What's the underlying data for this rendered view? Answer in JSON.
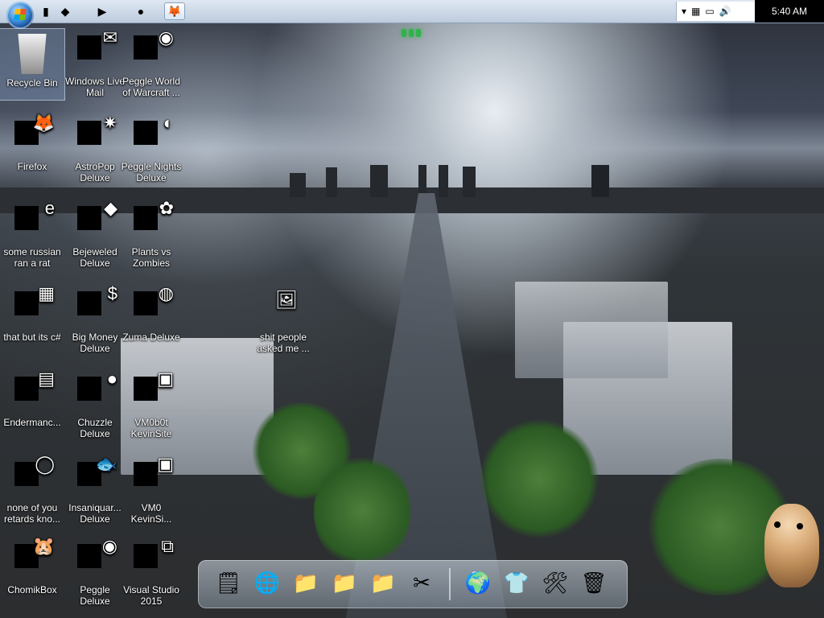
{
  "taskbar": {
    "start_icon": "windows-orb-icon",
    "items": [
      {
        "name": "app-red-square-icon",
        "glyph": "▮"
      },
      {
        "name": "app-black-shape-icon",
        "glyph": "◆"
      },
      {
        "name": "media-player-icon",
        "glyph": "▶"
      },
      {
        "name": "black-circle-icon",
        "glyph": "●"
      },
      {
        "name": "firefox-icon",
        "glyph": "🦊"
      }
    ],
    "tray": {
      "chevron_icon": "chevron-down-icon",
      "icons": [
        "network-icon",
        "monitor-icon",
        "volume-icon"
      ]
    },
    "clock": "5:40 AM"
  },
  "desktop": {
    "icons": [
      {
        "label": "Recycle Bin",
        "name": "recycle-bin-icon",
        "selected": true,
        "glyph": ""
      },
      {
        "label": "Windows Live Mail",
        "name": "windows-live-mail-icon",
        "selected": false,
        "glyph": "✉"
      },
      {
        "label": "Peggle World of Warcraft ...",
        "name": "peggle-world-of-warcraft-icon",
        "selected": false,
        "glyph": "◉"
      },
      {
        "label": "Firefox",
        "name": "firefox-icon",
        "selected": false,
        "glyph": "🦊"
      },
      {
        "label": "AstroPop Deluxe",
        "name": "astropop-deluxe-icon",
        "selected": false,
        "glyph": "✷"
      },
      {
        "label": "Peggle Nights Deluxe",
        "name": "peggle-nights-deluxe-icon",
        "selected": false,
        "glyph": "◐"
      },
      {
        "label": "some russian ran a rat",
        "name": "some-russian-ran-a-rat-icon",
        "selected": false,
        "glyph": "e"
      },
      {
        "label": "Bejeweled Deluxe",
        "name": "bejeweled-deluxe-icon",
        "selected": false,
        "glyph": "◆"
      },
      {
        "label": "Plants vs Zombies",
        "name": "plants-vs-zombies-icon",
        "selected": false,
        "glyph": "✿"
      },
      {
        "label": "that but its c#",
        "name": "that-but-its-c-sharp-icon",
        "selected": false,
        "glyph": "▦"
      },
      {
        "label": "Big Money Deluxe",
        "name": "big-money-deluxe-icon",
        "selected": false,
        "glyph": "$"
      },
      {
        "label": "Zuma Deluxe",
        "name": "zuma-deluxe-icon",
        "selected": false,
        "glyph": "◍"
      },
      {
        "label": "Endermanc...",
        "name": "endermanc-icon",
        "selected": false,
        "glyph": "▤"
      },
      {
        "label": "Chuzzle Deluxe",
        "name": "chuzzle-deluxe-icon",
        "selected": false,
        "glyph": "●"
      },
      {
        "label": "VM0b0t KevinSite",
        "name": "vm0b0t-kevinsite-icon",
        "selected": false,
        "glyph": "▣"
      },
      {
        "label": "none of you retards kno...",
        "name": "none-of-you-retards-know-icon",
        "selected": false,
        "glyph": "◯"
      },
      {
        "label": "Insaniquar... Deluxe",
        "name": "insaniquarium-deluxe-icon",
        "selected": false,
        "glyph": "🐟"
      },
      {
        "label": "VM0 KevinSi...",
        "name": "vm0-kevinsite-icon",
        "selected": false,
        "glyph": "▣"
      },
      {
        "label": "ChomikBox",
        "name": "chomikbox-icon",
        "selected": false,
        "glyph": "🐹"
      },
      {
        "label": "Peggle Deluxe",
        "name": "peggle-deluxe-icon",
        "selected": false,
        "glyph": "◉"
      },
      {
        "label": "Visual Studio 2015",
        "name": "visual-studio-2015-icon",
        "selected": false,
        "glyph": "⧉"
      },
      {
        "label": "shit people asked me ...",
        "name": "shit-people-asked-me-icon",
        "selected": false,
        "glyph": "🖼"
      }
    ]
  },
  "dock": {
    "items": [
      {
        "name": "dock-notes-icon",
        "glyph": "🗒"
      },
      {
        "name": "dock-globe-doc-icon",
        "glyph": "🌐"
      },
      {
        "name": "dock-folder-1-icon",
        "glyph": "📁"
      },
      {
        "name": "dock-folder-2-icon",
        "glyph": "📁"
      },
      {
        "name": "dock-folder-3-icon",
        "glyph": "📁"
      },
      {
        "name": "dock-tools-icon",
        "glyph": "✂"
      },
      {
        "name": "dock-internet-icon",
        "glyph": "🌍"
      },
      {
        "name": "dock-tshirt-icon",
        "glyph": "👕"
      },
      {
        "name": "dock-settings-icon",
        "glyph": "🛠"
      },
      {
        "name": "dock-recycle-bin-icon",
        "glyph": "🗑"
      }
    ]
  },
  "widgets": {
    "green_handle_icon": "handle-icon",
    "hamster_icon": "hamster-icon"
  }
}
